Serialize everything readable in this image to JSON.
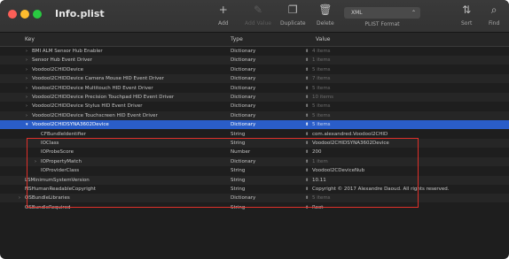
{
  "window": {
    "title": "Info.plist"
  },
  "toolbar": {
    "add": {
      "icon": "plus-icon",
      "glyph": "+",
      "label": "Add"
    },
    "add_value": {
      "icon": "pencil-icon",
      "glyph": "✎",
      "label": "Add Value"
    },
    "duplicate": {
      "icon": "duplicate-icon",
      "glyph": "❐",
      "label": "Duplicate"
    },
    "delete": {
      "icon": "trash-icon",
      "glyph": "🗑",
      "label": "Delete"
    },
    "format": {
      "value": "XML",
      "label": "PLIST Format"
    },
    "sort": {
      "icon": "sort-icon",
      "glyph": "⇅",
      "label": "Sort"
    },
    "find": {
      "icon": "search-icon",
      "glyph": "⌕",
      "label": "Find"
    }
  },
  "columns": {
    "key": "Key",
    "type": "Type",
    "value": "Value"
  },
  "rows": [
    {
      "key": "BMI ALM Sensor Hub Enabler",
      "type": "Dictionary",
      "value": "4 items",
      "indent": 1,
      "disclosure": "collapsed",
      "dim": true,
      "alt": false,
      "selected": false
    },
    {
      "key": "Sensor Hub Event Driver",
      "type": "Dictionary",
      "value": "1 items",
      "indent": 1,
      "disclosure": "collapsed",
      "dim": true,
      "alt": true,
      "selected": false
    },
    {
      "key": "VoodooI2CHIDDevice",
      "type": "Dictionary",
      "value": "5 items",
      "indent": 1,
      "disclosure": "collapsed",
      "dim": true,
      "alt": false,
      "selected": false
    },
    {
      "key": "VoodooI2CHIDDevice Camera Mouse HID Event Driver",
      "type": "Dictionary",
      "value": "7 items",
      "indent": 1,
      "disclosure": "collapsed",
      "dim": true,
      "alt": true,
      "selected": false
    },
    {
      "key": "VoodooI2CHIDDevice Multitouch HID Event Driver",
      "type": "Dictionary",
      "value": "5 items",
      "indent": 1,
      "disclosure": "collapsed",
      "dim": true,
      "alt": false,
      "selected": false
    },
    {
      "key": "VoodooI2CHIDDevice Precision Touchpad HID Event Driver",
      "type": "Dictionary",
      "value": "10 items",
      "indent": 1,
      "disclosure": "collapsed",
      "dim": true,
      "alt": true,
      "selected": false
    },
    {
      "key": "VoodooI2CHIDDevice Stylus HID Event Driver",
      "type": "Dictionary",
      "value": "5 items",
      "indent": 1,
      "disclosure": "collapsed",
      "dim": true,
      "alt": false,
      "selected": false
    },
    {
      "key": "VoodooI2CHIDDevice Touchscreen HID Event Driver",
      "type": "Dictionary",
      "value": "5 items",
      "indent": 1,
      "disclosure": "collapsed",
      "dim": true,
      "alt": true,
      "selected": false
    },
    {
      "key": "VoodooI2CHIDSYNA3602Device",
      "type": "Dictionary",
      "value": "5 items",
      "indent": 1,
      "disclosure": "expanded",
      "dim": true,
      "alt": false,
      "selected": true
    },
    {
      "key": "CFBundleIdentifier",
      "type": "String",
      "value": "com.alexandred.VoodooI2CHID",
      "indent": 2,
      "disclosure": "none",
      "dim": false,
      "alt": false,
      "selected": false
    },
    {
      "key": "IOClass",
      "type": "String",
      "value": "VoodooI2CHIDSYNA3602Device",
      "indent": 2,
      "disclosure": "none",
      "dim": false,
      "alt": true,
      "selected": false
    },
    {
      "key": "IOProbeScore",
      "type": "Number",
      "value": "200",
      "indent": 2,
      "disclosure": "none",
      "dim": false,
      "alt": false,
      "selected": false
    },
    {
      "key": "IOPropertyMatch",
      "type": "Dictionary",
      "value": "1 item",
      "indent": 2,
      "disclosure": "collapsed",
      "dim": true,
      "alt": true,
      "selected": false
    },
    {
      "key": "IOProviderClass",
      "type": "String",
      "value": "VoodooI2CDeviceNub",
      "indent": 2,
      "disclosure": "none",
      "dim": false,
      "alt": false,
      "selected": false
    },
    {
      "key": "LSMinimumSystemVersion",
      "type": "String",
      "value": "10.11",
      "indent": 0,
      "disclosure": "none",
      "dim": false,
      "alt": true,
      "selected": false
    },
    {
      "key": "NSHumanReadableCopyright",
      "type": "String",
      "value": "Copyright © 2017 Alexandre Daoud. All rights reserved.",
      "indent": 0,
      "disclosure": "none",
      "dim": false,
      "alt": false,
      "selected": false
    },
    {
      "key": "OSBundleLibraries",
      "type": "Dictionary",
      "value": "5 items",
      "indent": 0,
      "disclosure": "collapsed",
      "dim": true,
      "alt": true,
      "selected": false
    },
    {
      "key": "OSBundleRequired",
      "type": "String",
      "value": "Root",
      "indent": 0,
      "disclosure": "none",
      "dim": false,
      "alt": false,
      "selected": false
    }
  ],
  "colors": {
    "selection": "#2a5dc8",
    "highlight_box": "#e0302a"
  }
}
